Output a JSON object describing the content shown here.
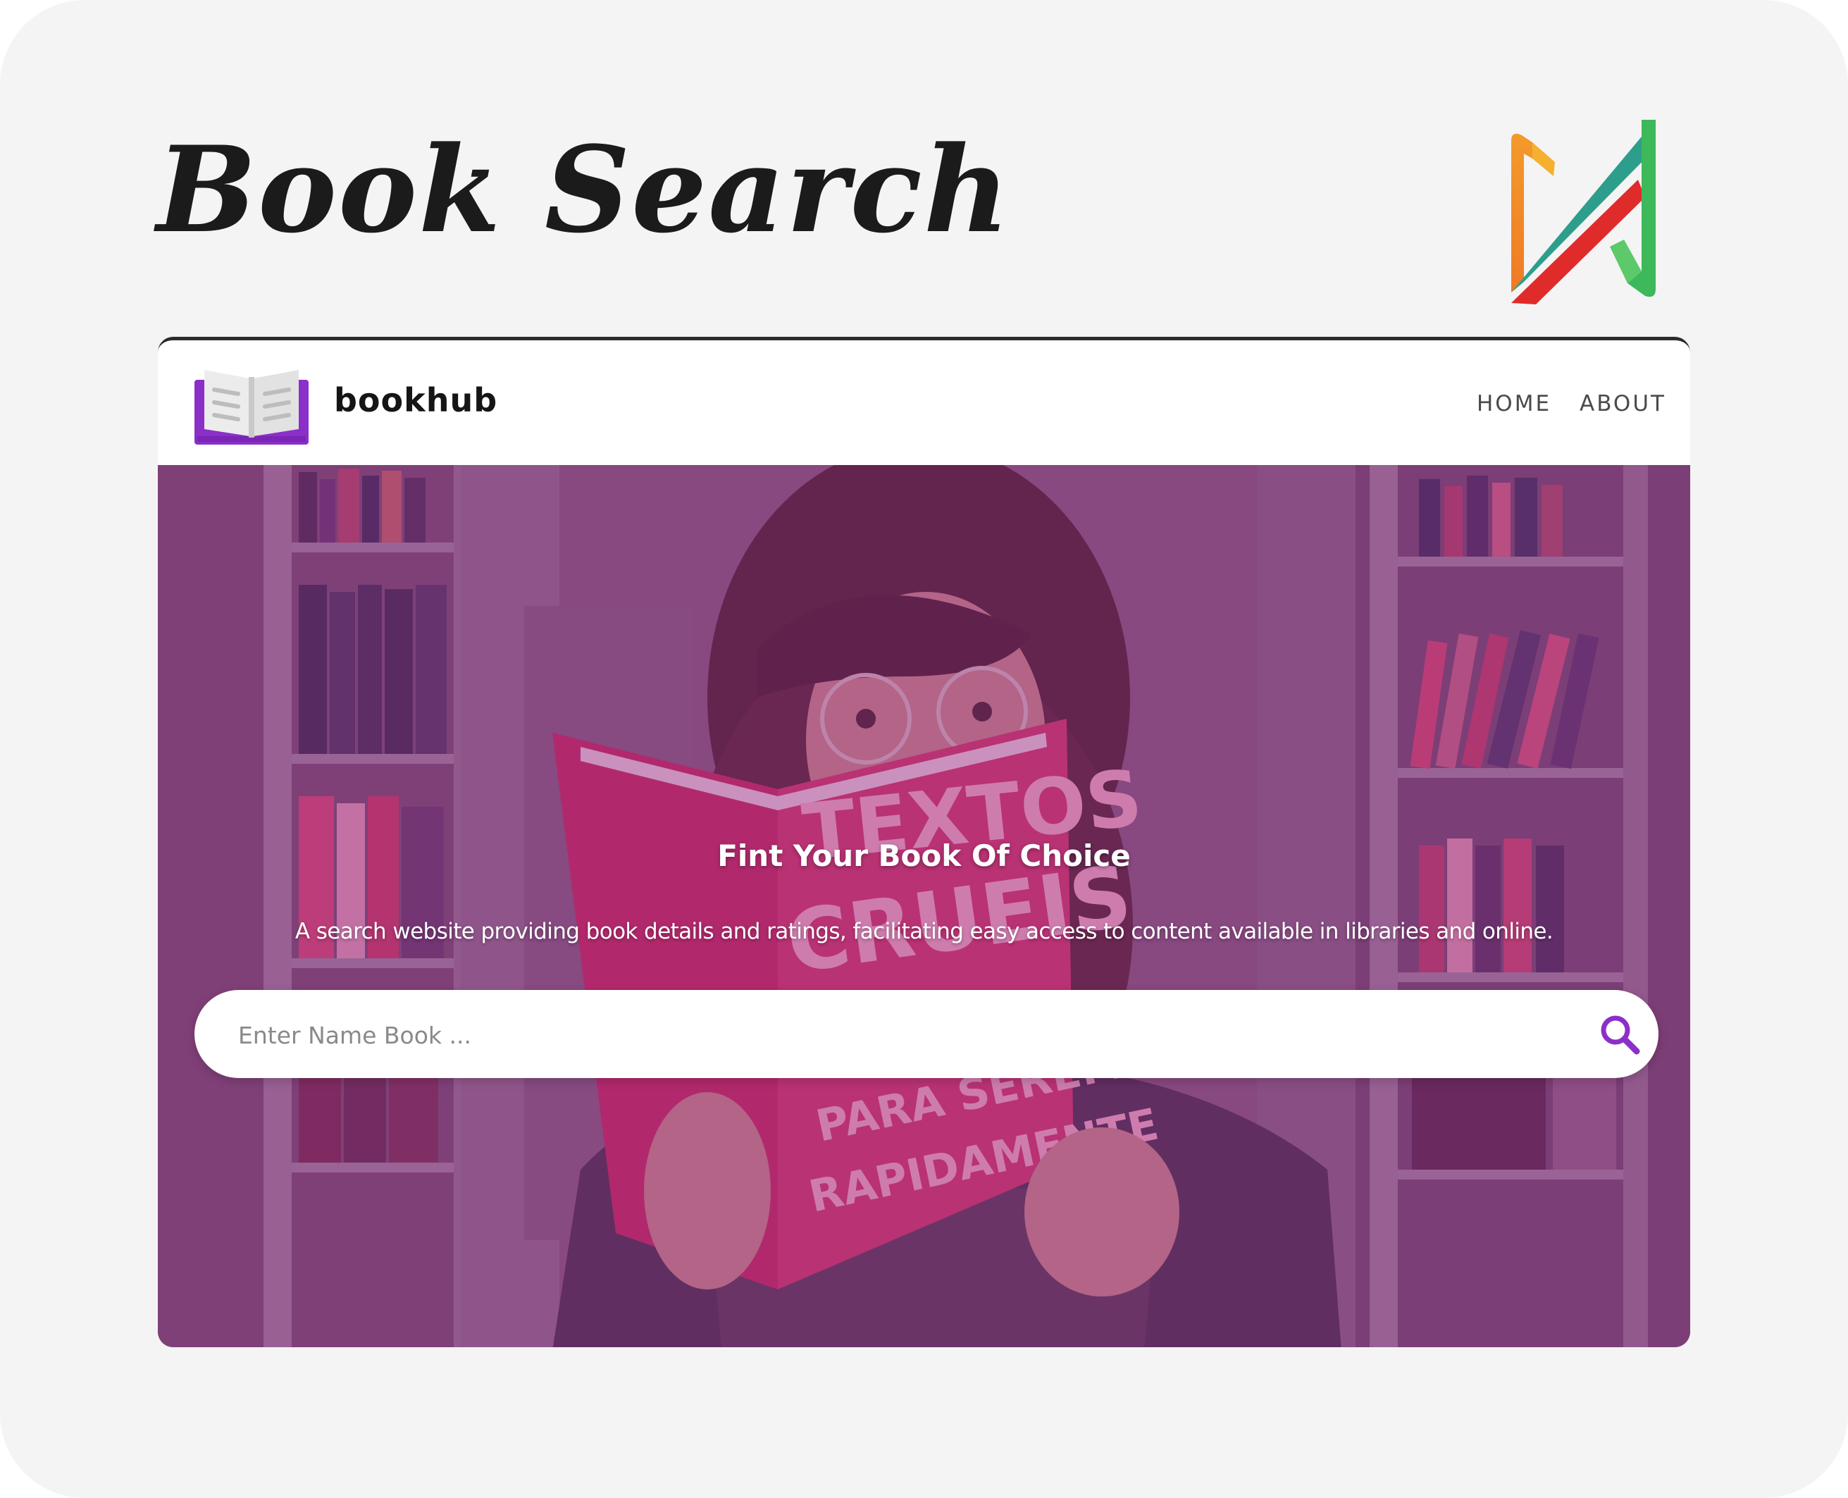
{
  "page": {
    "title": "Book  Search"
  },
  "app": {
    "brand": "bookhub",
    "nav": [
      {
        "label": "HOME"
      },
      {
        "label": "ABOUT"
      }
    ],
    "hero": {
      "title": "Fint Your Book Of Choice",
      "subtitle": "A search website providing book details and ratings, facilitating easy access to content available in libraries and online.",
      "book_cover_text": [
        "TEXTOS",
        "CRUEIS",
        "PARA SEREM",
        "RAPIDAMENTE"
      ]
    },
    "search": {
      "placeholder": "Enter Name Book ...",
      "value": "",
      "button_icon": "search-icon"
    }
  },
  "colors": {
    "accent_purple": "#8b2fc9",
    "overlay": "#96288c",
    "title_text": "#1b1b1b"
  }
}
